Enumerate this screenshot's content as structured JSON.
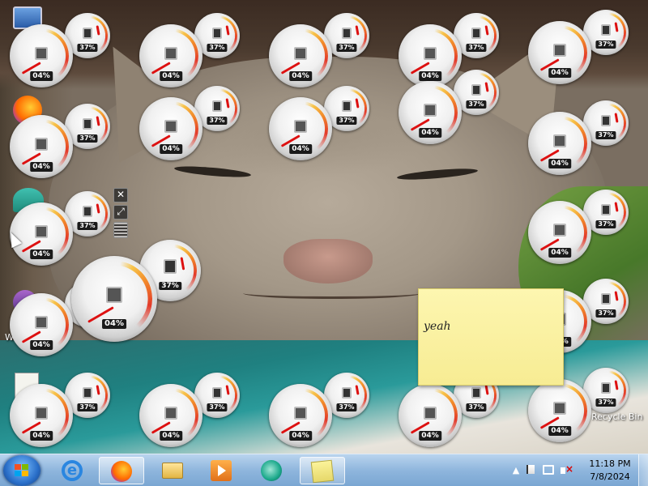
{
  "desktop": {
    "icons": [
      {
        "name": "computer-icon"
      },
      {
        "name": "firefox-icon"
      },
      {
        "name": "app-icon"
      },
      {
        "name": "user-folder-icon"
      },
      {
        "name": "document-icon"
      }
    ],
    "left_partial_label": "W",
    "recycle_bin_label": "Recycle Bin"
  },
  "gadgets": {
    "cpu_meter": {
      "cpu_value": "04%",
      "memory_value": "37%",
      "cpu_level": 0.04,
      "memory_level": 0.37,
      "count_small": 26,
      "count_large": 1
    },
    "toolbar": {
      "close_glyph": "✕",
      "resize_glyph": "⤢"
    }
  },
  "sticky_note": {
    "text": "yeah",
    "color": "#f7ec93"
  },
  "taskbar": {
    "start_icon": "windows-orb-icon",
    "pinned": [
      {
        "name": "internet-explorer",
        "icon": "internet-explorer-icon",
        "glyph": "e",
        "active": false
      },
      {
        "name": "firefox",
        "icon": "firefox-icon",
        "active": true
      },
      {
        "name": "windows-explorer",
        "icon": "folder-icon",
        "active": false
      },
      {
        "name": "media-player",
        "icon": "media-player-icon",
        "active": false
      },
      {
        "name": "teal-app",
        "icon": "teal-app-icon",
        "active": false
      },
      {
        "name": "sticky-notes",
        "icon": "sticky-notes-icon",
        "active": true
      }
    ],
    "tray": {
      "show_hidden_glyph": "▲",
      "time": "11:18 PM",
      "date": "7/8/2024"
    }
  },
  "colors": {
    "taskbar": "#8fb6dd",
    "gauge_red": "#e33a2a",
    "gauge_orange": "#f28a2a",
    "gauge_yellow": "#f7c44a"
  }
}
